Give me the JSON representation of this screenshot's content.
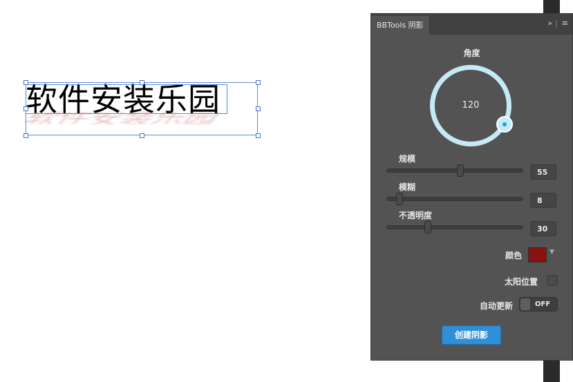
{
  "canvas": {
    "text": "软件安装乐园"
  },
  "panel": {
    "tab_title": "BBTools 阴影",
    "header_icons": {
      "expand": "»",
      "menu": "≡"
    },
    "angle": {
      "label": "角度",
      "value": "120"
    },
    "scale": {
      "label": "规模",
      "value": "55"
    },
    "blur": {
      "label": "模糊",
      "value": "8"
    },
    "opacity": {
      "label": "不透明度",
      "value": "30"
    },
    "color": {
      "label": "颜色",
      "swatch": "#8b1111"
    },
    "sun_position": {
      "label": "太阳位置",
      "checked": false
    },
    "auto_update": {
      "label": "自动更新",
      "state": "OFF"
    },
    "create_button": "创建阴影"
  }
}
